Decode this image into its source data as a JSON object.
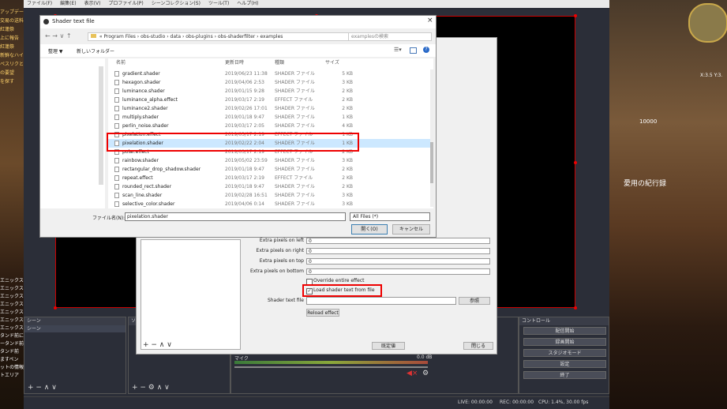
{
  "game": {
    "left_texts": [
      "アップデート",
      "交易の送料",
      "紅蓮祭",
      "上に報告",
      "紅蓮祭",
      "新鮮なハイ",
      "ペスリクとに",
      "の要望",
      "を探す"
    ],
    "right_texts": [
      "X:3.5 Y:3.",
      "愛用の紀行録",
      "10000"
    ],
    "left_chat": [
      "エニックス",
      "エニックス",
      "エニックス",
      "エニックス",
      "エニックス",
      "エニックス",
      "エニックス",
      "タンド前に",
      "ータンド前",
      "タンド前",
      "ますペン",
      "ットの情報",
      "トエリア"
    ]
  },
  "obs": {
    "menu": [
      "ファイル(F)",
      "編集(E)",
      "表示(V)",
      "プロファイル(P)",
      "シーンコレクション(S)",
      "ツール(T)",
      "ヘルプ(H)"
    ],
    "scenes_title": "シーン",
    "scene_item": "シーン",
    "controls_title": "コントロール",
    "controls": [
      "配信開始",
      "録画開始",
      "スタジオモード",
      "設定",
      "終了"
    ],
    "mixer_label": "マイク",
    "mixer_db": "0.0 dB",
    "status": {
      "live": "LIVE: 00:00:00",
      "rec": "REC: 00:00:00",
      "cpu": "CPU: 1.4%, 30.00 fps"
    }
  },
  "filters": {
    "fields": [
      {
        "label": "Extra pixels on left",
        "value": "0"
      },
      {
        "label": "Extra pixels on right",
        "value": "0"
      },
      {
        "label": "Extra pixels on top",
        "value": "0"
      },
      {
        "label": "Extra pixels on bottom",
        "value": "0"
      }
    ],
    "override_label": "Override entire effect",
    "load_label": "Load shader text from file",
    "shader_file_label": "Shader text file",
    "browse_label": "参照",
    "reload_label": "Reload effect",
    "defaults_label": "既定値",
    "close_label": "閉じる"
  },
  "dialog": {
    "title": "Shader text file",
    "breadcrumb": [
      "Program Files",
      "obs-studio",
      "data",
      "obs-plugins",
      "obs-shaderfilter",
      "examples"
    ],
    "search_placeholder": "examplesの検索",
    "organize": "整理 ▼",
    "new_folder": "新しいフォルダー",
    "columns": {
      "name": "名前",
      "date": "更新日時",
      "type": "種類",
      "size": "サイズ"
    },
    "files": [
      {
        "name": "gradient.shader",
        "date": "2019/06/23 11:38",
        "type": "SHADER ファイル",
        "size": "5 KB"
      },
      {
        "name": "hexagon.shader",
        "date": "2019/04/06 2:53",
        "type": "SHADER ファイル",
        "size": "3 KB"
      },
      {
        "name": "luminance.shader",
        "date": "2019/01/15 9:28",
        "type": "SHADER ファイル",
        "size": "2 KB"
      },
      {
        "name": "luminance_alpha.effect",
        "date": "2019/03/17 2:19",
        "type": "EFFECT ファイル",
        "size": "2 KB"
      },
      {
        "name": "luminance2.shader",
        "date": "2019/02/26 17:01",
        "type": "SHADER ファイル",
        "size": "2 KB"
      },
      {
        "name": "multiply.shader",
        "date": "2019/01/18 9:47",
        "type": "SHADER ファイル",
        "size": "1 KB"
      },
      {
        "name": "perlin_noise.shader",
        "date": "2019/03/17 2:05",
        "type": "SHADER ファイル",
        "size": "4 KB"
      },
      {
        "name": "pixelation.effect",
        "date": "2019/03/17 2:19",
        "type": "EFFECT ファイル",
        "size": "1 KB"
      },
      {
        "name": "pixelation.shader",
        "date": "2019/02/22 2:04",
        "type": "SHADER ファイル",
        "size": "1 KB"
      },
      {
        "name": "polar.effect",
        "date": "2019/03/17 2:19",
        "type": "EFFECT ファイル",
        "size": "2 KB"
      },
      {
        "name": "rainbow.shader",
        "date": "2019/05/02 23:59",
        "type": "SHADER ファイル",
        "size": "3 KB"
      },
      {
        "name": "rectangular_drop_shadow.shader",
        "date": "2019/01/18 9:47",
        "type": "SHADER ファイル",
        "size": "2 KB"
      },
      {
        "name": "repeat.effect",
        "date": "2019/03/17 2:19",
        "type": "EFFECT ファイル",
        "size": "2 KB"
      },
      {
        "name": "rounded_rect.shader",
        "date": "2019/01/18 9:47",
        "type": "SHADER ファイル",
        "size": "2 KB"
      },
      {
        "name": "scan_line.shader",
        "date": "2019/02/28 16:51",
        "type": "SHADER ファイル",
        "size": "3 KB"
      },
      {
        "name": "selective_color.shader",
        "date": "2019/04/06 0:14",
        "type": "SHADER ファイル",
        "size": "3 KB"
      }
    ],
    "filename_label": "ファイル名(N):",
    "filename_value": "pixelation.shader",
    "filter_value": "All Files (*)",
    "open_label": "開く(O)",
    "cancel_label": "キャンセル"
  },
  "colors": {
    "highlight": "#e00000",
    "selected_row": "#cce8ff"
  }
}
